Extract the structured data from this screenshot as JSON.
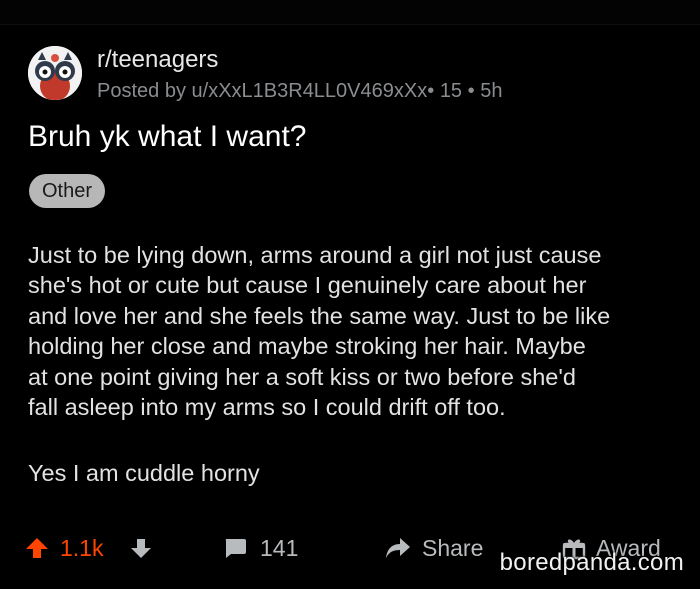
{
  "post": {
    "subreddit": "r/teenagers",
    "meta_prefix": "Posted by",
    "author": "u/xXxL1B3R4LL0V469xXx",
    "meta_sep1": "•",
    "author_flair": "15",
    "meta_sep2": "•",
    "age": "5h",
    "title": "Bruh yk what I want?",
    "flair": "Other",
    "body_lines": [
      "Just to be lying down, arms around a girl not just cause",
      "she's hot or cute but cause I genuinely care about her",
      "and love her and she feels the same way. Just to be like",
      "holding her close and maybe stroking her hair. Maybe",
      "at one point giving her a soft kiss or two before she'd",
      "fall asleep into my arms so I could drift off too."
    ],
    "body_para2": "Yes I am cuddle horny"
  },
  "actions": {
    "upvotes": "1.1k",
    "comments": "141",
    "share_label": "Share",
    "award_label": "Award"
  },
  "watermark": "boredpanda.com",
  "colors": {
    "background": "#000000",
    "upvote_accent": "#ff4500",
    "flair_bg": "#b7b7b7",
    "muted": "#8a8d90"
  },
  "icons": {
    "avatar": "subreddit-avatar",
    "upvote": "upvote-arrow-icon",
    "downvote": "downvote-arrow-icon",
    "comments": "comment-bubble-icon",
    "share": "share-arrow-icon",
    "award": "gift-award-icon"
  }
}
